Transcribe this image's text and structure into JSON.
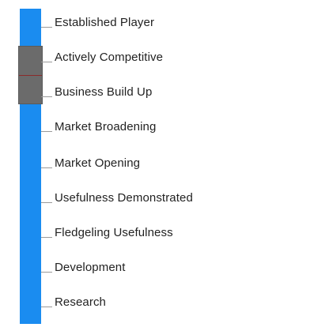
{
  "stages": [
    {
      "label": "Established Player"
    },
    {
      "label": "Actively Competitive"
    },
    {
      "label": "Business Build Up"
    },
    {
      "label": "Market Broadening"
    },
    {
      "label": "Market Opening"
    },
    {
      "label": "Usefulness Demonstrated"
    },
    {
      "label": "Fledgeling Usefulness"
    },
    {
      "label": "Development"
    },
    {
      "label": "Research"
    }
  ],
  "selection": {
    "from": "Business Build Up",
    "to": "Actively Competitive"
  },
  "colors": {
    "track": "#1a8cf0",
    "handle": "#6b6b6b",
    "handle_divider": "#8b2b2b",
    "tick": "#9a9a9a",
    "text": "#222222"
  }
}
